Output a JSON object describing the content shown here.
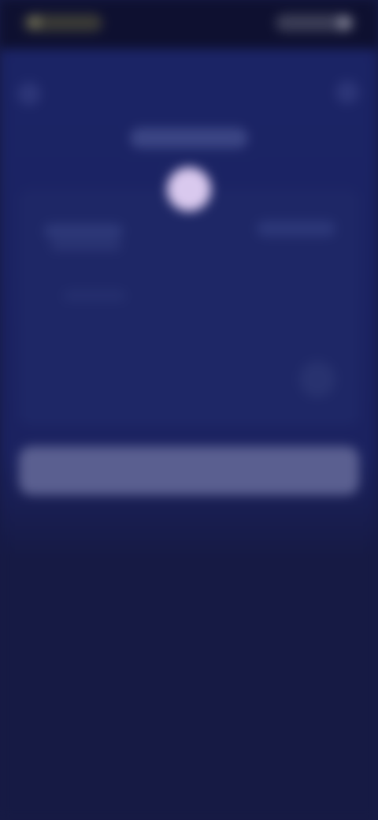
{
  "colors": {
    "background_top": "#1b2466",
    "background_bottom": "#161a44",
    "status_bar": "#0e1030",
    "card": "#1e2766",
    "avatar": "#d9c9ee",
    "primary_button": "#5a5f90"
  },
  "icons": {
    "back": "back-arrow-icon",
    "action": "more-options-icon",
    "avatar": "avatar",
    "card_action": "card-action-icon"
  }
}
